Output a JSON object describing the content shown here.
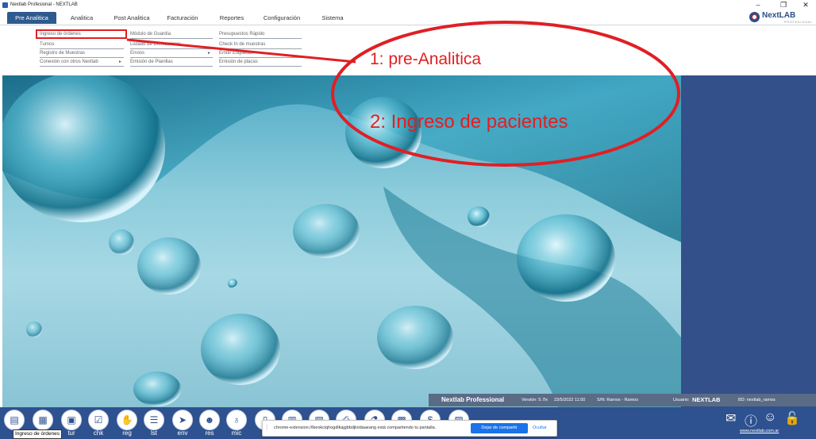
{
  "window": {
    "title": "Nextlab Profesional - NEXTLAB",
    "controls": [
      "–",
      "❐",
      "✕"
    ]
  },
  "menu": {
    "tabs": [
      "Pre Analitica",
      "Analitica",
      "Post Analitica",
      "Facturación",
      "Reportes",
      "Configuración",
      "Sistema"
    ],
    "active_tab": "Pre Analitica"
  },
  "logo": {
    "name": "NextLAB",
    "tagline": "PROFESIONAL"
  },
  "submenu": {
    "col1": [
      {
        "label": "Ingreso de órdenes",
        "has_arrow": false
      },
      {
        "label": "Turnos",
        "has_arrow": false
      },
      {
        "label": "Registro de Muestras",
        "has_arrow": false
      },
      {
        "label": "Conexión con otros Nextlab",
        "has_arrow": true
      }
    ],
    "col2": [
      {
        "label": "Módulo de Guardia",
        "has_arrow": false
      },
      {
        "label": "Listado de Derivaciones",
        "has_arrow": false
      },
      {
        "label": "Envios",
        "has_arrow": true
      },
      {
        "label": "Emisión de Planillas",
        "has_arrow": false
      }
    ],
    "col3": [
      {
        "label": "Presupuestos Rápido",
        "has_arrow": false
      },
      {
        "label": "Check In de muestras",
        "has_arrow": false
      },
      {
        "label": "Emitir Etiquetas",
        "has_arrow": false
      },
      {
        "label": "Emisión de placas",
        "has_arrow": false
      }
    ]
  },
  "annotations": {
    "step1": "1: pre-Analitica",
    "step2": "2: Ingreso de pacientes",
    "color": "#e01f24"
  },
  "status": {
    "app": "Nextlab Professional",
    "version": "Versión: 5.7lx",
    "datetime": "23/5/2022 11:50",
    "sn": "S/N: Ramos - Ramos",
    "user_label": "Usuario:",
    "user": "NEXTLAB",
    "bd": "BD: nextlab_ramos"
  },
  "toolbar": {
    "buttons": [
      {
        "label": "",
        "icon": "document-icon"
      },
      {
        "label": "",
        "icon": "grid-icon"
      },
      {
        "label": "tur",
        "icon": "calendar-icon"
      },
      {
        "label": "chk",
        "icon": "checklist-icon"
      },
      {
        "label": "reg",
        "icon": "hand-tube-icon"
      },
      {
        "label": "lst",
        "icon": "list-icon"
      },
      {
        "label": "env",
        "icon": "send-icon"
      },
      {
        "label": "res",
        "icon": "person-icon"
      },
      {
        "label": "mic",
        "icon": "microscope-icon"
      },
      {
        "label": "p",
        "icon": "page-icon"
      },
      {
        "label": "",
        "icon": "table-icon"
      },
      {
        "label": "",
        "icon": "report-icon"
      },
      {
        "label": "",
        "icon": "printer-icon"
      },
      {
        "label": "",
        "icon": "flask-icon"
      },
      {
        "label": "",
        "icon": "calculator-icon"
      },
      {
        "label": "",
        "icon": "dollar-icon"
      },
      {
        "label": "",
        "icon": "archive-icon"
      }
    ],
    "tooltip": "Ingreso de órdenes"
  },
  "share": {
    "message": "chrome-extension://lkeokciqhogdlkajgbbdjloidaaeang está compartiendo tu pantalla.",
    "stop_label": "Dejar de compartir",
    "hide_label": "Ocultar"
  },
  "tray": {
    "site": "www.nextlab.com.ar"
  },
  "colors": {
    "taskbar": "#2e5190",
    "right_panel": "#33508a",
    "active_tab": "#2e5a8e"
  }
}
